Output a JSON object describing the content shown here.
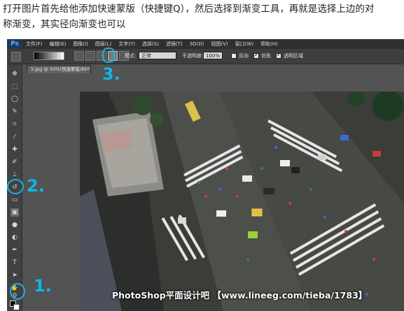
{
  "caption": {
    "line1": "打开图片首先给他添加快速蒙版（快捷键Q），然后选择到渐变工具，再就是选择上边的对",
    "line2": "称渐变，其实径向渐变也可以"
  },
  "photoshop": {
    "logo": "Ps",
    "menu": [
      "文件(F)",
      "编辑(E)",
      "图像(I)",
      "图层(L)",
      "文字(Y)",
      "选择(S)",
      "滤镜(T)",
      "3D(D)",
      "视图(V)",
      "窗口(W)",
      "帮助(H)"
    ],
    "options": {
      "mode_label": "模式:",
      "mode_value": "正常",
      "opacity_label": "不透明度:",
      "opacity_value": "100%",
      "reverse_label": "反向",
      "dither_label": "仿色",
      "transparency_label": "透明区域"
    },
    "document_tab": "5.jpg @ 50%(快速蒙版/8) *",
    "document_tab_close": "×"
  },
  "annotations": {
    "step1": "1.",
    "step2": "2.",
    "step3": "3."
  },
  "watermark": "PhotoShop平面设计吧 【www.lineeg.com/tieba/1783】",
  "colors": {
    "annotation": "#14b4e6",
    "menubar": "#2f2f2f",
    "toolbar": "#424242"
  }
}
